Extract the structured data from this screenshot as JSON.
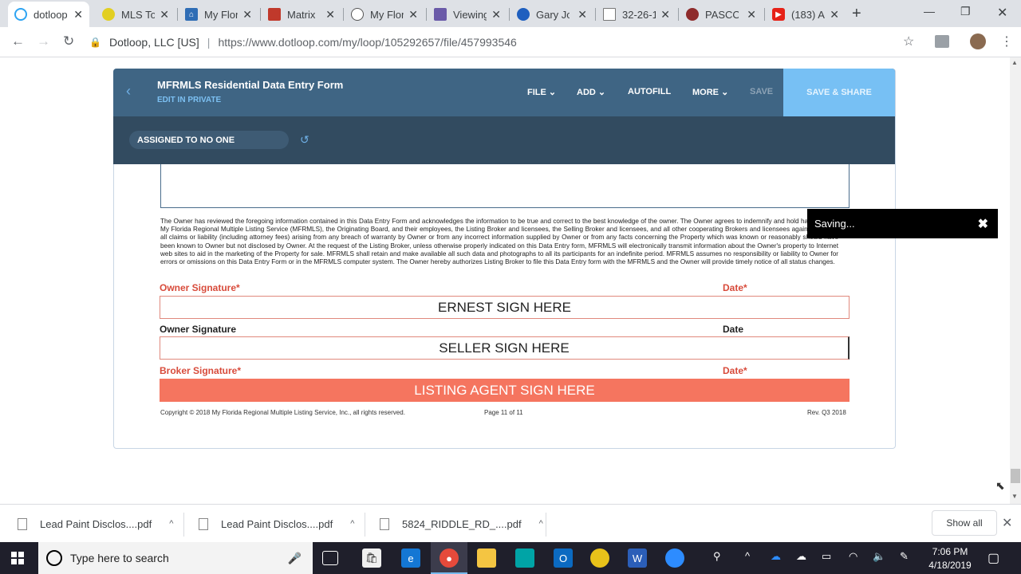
{
  "browser": {
    "tabs": [
      {
        "title": "dotloop",
        "favicon": "dotloop-icon",
        "color": "#2ea4f2"
      },
      {
        "title": "MLS To",
        "favicon": "mls-icon",
        "color": "#e2cf22"
      },
      {
        "title": "My Flor",
        "favicon": "home-icon",
        "color": "#2f6db5"
      },
      {
        "title": "Matrix",
        "favicon": "matrix-icon",
        "color": "#c0392b"
      },
      {
        "title": "My Flor",
        "favicon": "pin-icon",
        "color": "#555555"
      },
      {
        "title": "Viewing",
        "favicon": "viewing-icon",
        "color": "#6a5aa8"
      },
      {
        "title": "Gary Jo",
        "favicon": "link-icon",
        "color": "#1f5fbf"
      },
      {
        "title": "32-26-1",
        "favicon": "doc-icon",
        "color": "#777777"
      },
      {
        "title": "PASCO",
        "favicon": "seal-icon",
        "color": "#8e2b2b"
      },
      {
        "title": "(183) A",
        "favicon": "youtube-icon",
        "color": "#e62117"
      }
    ],
    "address": {
      "org": "Dotloop, LLC [US]",
      "url": "https://www.dotloop.com/my/loop/105292657/file/457993546"
    }
  },
  "app": {
    "title": "MFRMLS Residential Data Entry Form",
    "subtitle": "EDIT IN PRIVATE",
    "menus": {
      "file": "FILE",
      "add": "ADD",
      "autofill": "AUTOFILL",
      "more": "MORE",
      "save": "SAVE",
      "save_share": "SAVE & SHARE"
    },
    "assigned": "ASSIGNED TO NO ONE"
  },
  "document": {
    "legal_text": "The Owner has reviewed the foregoing information contained in this Data Entry Form and acknowledges the information to be true and correct to the best knowledge of the owner. The Owner agrees to indemnify and hold harmless the My Florida Regional Multiple Listing Service (MFRMLS), the Originating Board, and their employees, the Listing Broker and licensees, the Selling Broker and licensees, and all other cooperating Brokers and licensees against any and all claims or liability (including attorney fees) arising from any breach of warranty by Owner or from any incorrect information supplied by Owner or from any facts concerning the Property which was known or reasonably should have been known to Owner but not disclosed by Owner. At the request of the Listing Broker, unless otherwise properly indicated on this Data Entry form, MFRMLS will electronically transmit information about the Owner's property to Internet web sites to aid in the marketing of the Property for sale. MFRMLS shall retain and make available all such data and photographs to all its participants for an indefinite period. MFRMLS assumes no responsibility or liability to Owner for errors or omissions on this Data Entry Form or in the MFRMLS computer system. The Owner hereby authorizes Listing Broker to file this Data Entry form with the MFRMLS and the Owner will provide timely notice of all status changes.",
    "owner_sig_label_1": "Owner Signature*",
    "date_label_1": "Date*",
    "sig_box_1": "ERNEST SIGN HERE",
    "owner_sig_label_2": "Owner Signature",
    "date_label_2": "Date",
    "sig_box_2": "SELLER SIGN HERE",
    "broker_sig_label": "Broker Signature*",
    "date_label_3": "Date*",
    "sig_box_3": "LISTING AGENT SIGN HERE",
    "copyright": "Copyright © 2018 My Florida Regional Multiple Listing Service, Inc., all rights reserved.",
    "page": "Page 11 of 11",
    "revision": "Rev. Q3 2018"
  },
  "toast": {
    "text": "Saving..."
  },
  "downloads": [
    {
      "name": "Lead Paint Disclos....pdf"
    },
    {
      "name": "Lead Paint Disclos....pdf"
    },
    {
      "name": "5824_RIDDLE_RD_....pdf"
    }
  ],
  "downloads_show_all": "Show all",
  "taskbar": {
    "search_placeholder": "Type here to search",
    "time": "7:06 PM",
    "date": "4/18/2019"
  },
  "colors": {
    "header": "#3f6584",
    "assign_bar": "#324b60",
    "save_share": "#77c0f4",
    "required_red": "#d84b3b",
    "agent_sign_fill": "#f5755f"
  }
}
